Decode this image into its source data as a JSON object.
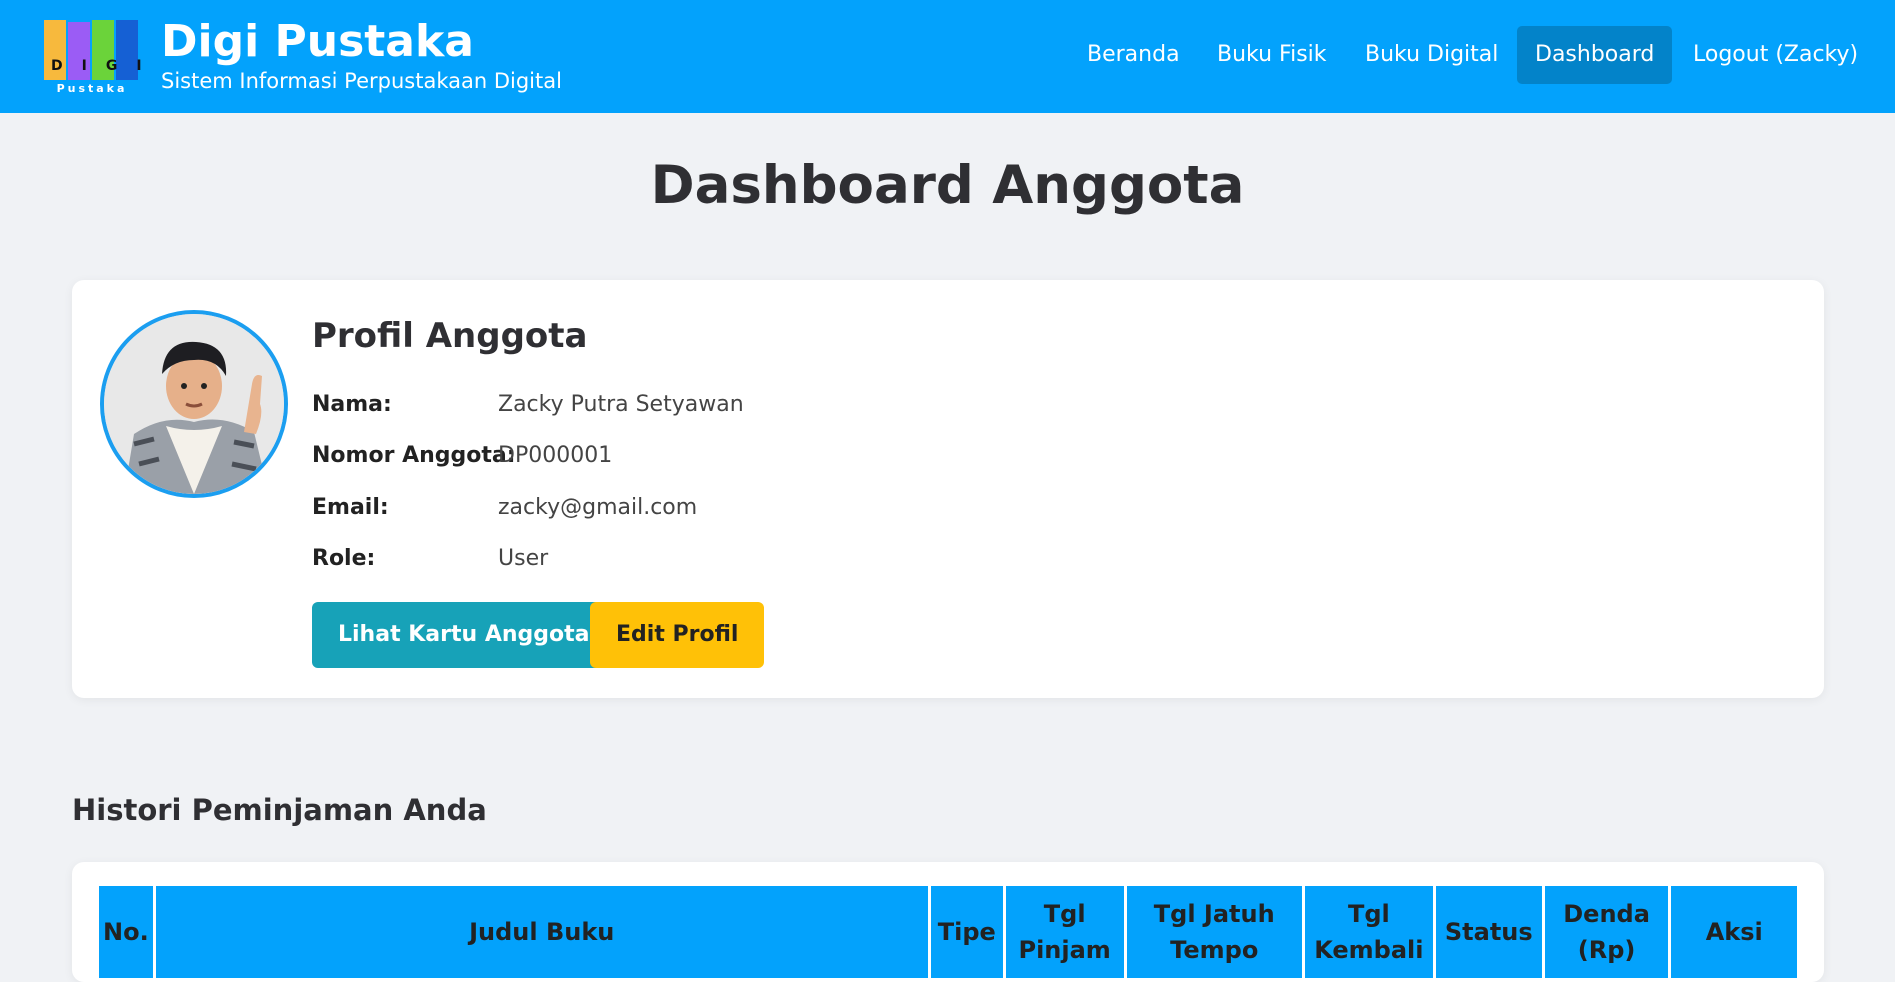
{
  "header": {
    "logo_text": "DIGI",
    "logo_sub": "Pustaka",
    "title": "Digi Pustaka",
    "subtitle": "Sistem Informasi Perpustakaan Digital",
    "nav": [
      {
        "label": "Beranda",
        "active": false
      },
      {
        "label": "Buku Fisik",
        "active": false
      },
      {
        "label": "Buku Digital",
        "active": false
      },
      {
        "label": "Dashboard",
        "active": true
      },
      {
        "label": "Logout (Zacky)",
        "active": false
      }
    ],
    "colors": {
      "bar": "#03a2fc",
      "active": "#0383c9"
    }
  },
  "page_title": "Dashboard Anggota",
  "profile": {
    "title": "Profil Anggota",
    "fields": [
      {
        "label": "Nama:",
        "value": "Zacky Putra Setyawan"
      },
      {
        "label": "Nomor Anggota:",
        "value": "DP000001"
      },
      {
        "label": "Email:",
        "value": "zacky@gmail.com"
      },
      {
        "label": "Role:",
        "value": "User"
      }
    ],
    "buttons": {
      "card": "Lihat Kartu Anggota",
      "edit": "Edit Profil"
    }
  },
  "history": {
    "title": "Histori Peminjaman Anda",
    "columns": [
      "No.",
      "Judul Buku",
      "Tipe",
      "Tgl Pinjam",
      "Tgl Jatuh Tempo",
      "Tgl Kembali",
      "Status",
      "Denda (Rp)",
      "Aksi"
    ]
  }
}
